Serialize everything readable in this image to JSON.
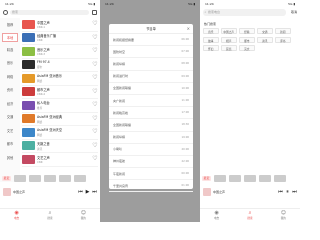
{
  "status": {
    "time": "11:24",
    "right": "5G ▮"
  },
  "s1": {
    "search_placeholder": "搜索",
    "categories": [
      "推荐",
      "本地",
      "精选",
      "音乐",
      "网络",
      "资讯",
      "经济",
      "交通",
      "文艺",
      "都市",
      "其他"
    ],
    "items": [
      {
        "name": "中国之声",
        "sub": "CNR-1",
        "color": "#e8564f"
      },
      {
        "name": "经典音乐广播",
        "sub": "CNR",
        "color": "#3b6fb6"
      },
      {
        "name": "音乐之声",
        "sub": "CNR-3",
        "color": "#8cbf44"
      },
      {
        "name": "FM 97.4",
        "sub": "都市",
        "color": "#2c2c2c"
      },
      {
        "name": "AsiaFM 亚洲音乐",
        "sub": "网络",
        "color": "#e59a2a"
      },
      {
        "name": "都市之声",
        "sub": "CNR-4",
        "color": "#cd3d3d"
      },
      {
        "name": "私人电台",
        "sub": "推荐",
        "color": "#7a4fb0"
      },
      {
        "name": "AsiaFM 亚洲经典",
        "sub": "网络",
        "color": "#e07a2a"
      },
      {
        "name": "AsiaFM 亚洲天空",
        "sub": "网络",
        "color": "#3d87c9"
      },
      {
        "name": "天籁之音",
        "sub": "资讯",
        "color": "#4db0a2"
      },
      {
        "name": "文艺之声",
        "sub": "CNR",
        "color": "#c44a62"
      }
    ],
    "recent_label": "最近",
    "player_title": "中国之声",
    "tabs": [
      "电台",
      "搜索",
      "我的"
    ]
  },
  "s2": {
    "dialog_title": "节目单",
    "rows": [
      {
        "t": "新闻和报纸摘要",
        "tm": "06:00"
      },
      {
        "t": "国防时空",
        "tm": "07:00"
      },
      {
        "t": "新闻纵横",
        "tm": "08:00"
      },
      {
        "t": "新闻进行时",
        "tm": "09:00"
      },
      {
        "t": "全国新闻联播",
        "tm": "10:00"
      },
      {
        "t": "央广新闻",
        "tm": "11:00"
      },
      {
        "t": "新闻晚高峰",
        "tm": "17:00"
      },
      {
        "t": "全国新闻联播",
        "tm": "18:30"
      },
      {
        "t": "新闻纵横",
        "tm": "19:00"
      },
      {
        "t": "小喇叭",
        "tm": "20:00"
      },
      {
        "t": "神州夜航",
        "tm": "22:00"
      },
      {
        "t": "午夜新闻",
        "tm": "00:00"
      },
      {
        "t": "千里共良宵",
        "tm": "01:00"
      }
    ]
  },
  "s3": {
    "search_placeholder": "搜索电台",
    "cancel": "取消",
    "hot_title": "热门搜索",
    "chips": [
      "音乐",
      "中国之声",
      "经典",
      "交通",
      "新闻",
      "故事",
      "相声",
      "都市",
      "资讯",
      "评书",
      "怀旧",
      "民谣",
      "英文"
    ]
  }
}
